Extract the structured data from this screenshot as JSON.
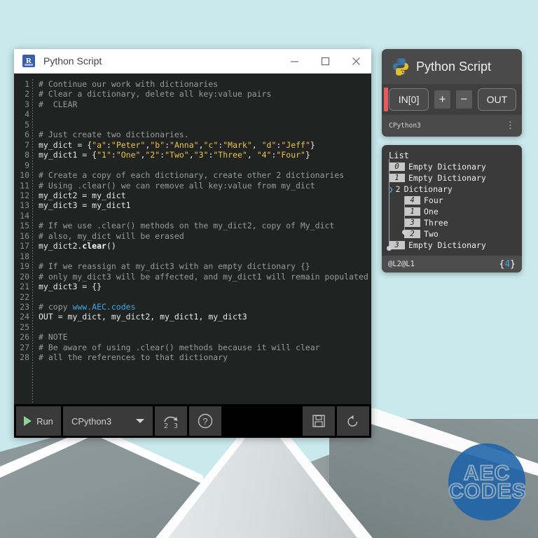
{
  "window": {
    "title": "Python Script",
    "app_icon": "revit-icon",
    "icon_letter": "R",
    "controls": {
      "minimize": "minimize-icon",
      "maximize": "maximize-icon",
      "close": "close-icon"
    }
  },
  "editor": {
    "line_numbers": [
      "1",
      "2",
      "3",
      "4",
      "5",
      "6",
      "7",
      "8",
      "9",
      "10",
      "11",
      "12",
      "13",
      "14",
      "15",
      "16",
      "17",
      "18",
      "19",
      "20",
      "21",
      "22",
      "23",
      "24",
      "25",
      "26",
      "27",
      "28"
    ],
    "lines": [
      {
        "n": 1,
        "tokens": [
          {
            "t": "# Continue our work with dictionaries",
            "c": "cmt"
          }
        ]
      },
      {
        "n": 2,
        "tokens": [
          {
            "t": "# Clear a dictionary, delete all key:value pairs",
            "c": "cmt"
          }
        ]
      },
      {
        "n": 3,
        "tokens": [
          {
            "t": "#  CLEAR",
            "c": "cmt"
          }
        ]
      },
      {
        "n": 4,
        "tokens": []
      },
      {
        "n": 5,
        "tokens": []
      },
      {
        "n": 6,
        "tokens": [
          {
            "t": "# Just create two dictionaries.",
            "c": "cmt"
          }
        ]
      },
      {
        "n": 7,
        "tokens": [
          {
            "t": "my_dict = {",
            "c": ""
          },
          {
            "t": "\"a\"",
            "c": "str"
          },
          {
            "t": ":",
            "c": ""
          },
          {
            "t": "\"Peter\"",
            "c": "str"
          },
          {
            "t": ",",
            "c": ""
          },
          {
            "t": "\"b\"",
            "c": "str"
          },
          {
            "t": ":",
            "c": ""
          },
          {
            "t": "\"Anna\"",
            "c": "str"
          },
          {
            "t": ",",
            "c": ""
          },
          {
            "t": "\"c\"",
            "c": "str"
          },
          {
            "t": ":",
            "c": ""
          },
          {
            "t": "\"Mark\"",
            "c": "str"
          },
          {
            "t": ", ",
            "c": ""
          },
          {
            "t": "\"d\"",
            "c": "str"
          },
          {
            "t": ":",
            "c": ""
          },
          {
            "t": "\"Jeff\"",
            "c": "str"
          },
          {
            "t": "}",
            "c": ""
          }
        ]
      },
      {
        "n": 8,
        "tokens": [
          {
            "t": "my_dict1 = {",
            "c": ""
          },
          {
            "t": "\"1\"",
            "c": "str"
          },
          {
            "t": ":",
            "c": ""
          },
          {
            "t": "\"One\"",
            "c": "str"
          },
          {
            "t": ",",
            "c": ""
          },
          {
            "t": "\"2\"",
            "c": "str"
          },
          {
            "t": ":",
            "c": ""
          },
          {
            "t": "\"Two\"",
            "c": "str"
          },
          {
            "t": ",",
            "c": ""
          },
          {
            "t": "\"3\"",
            "c": "str"
          },
          {
            "t": ":",
            "c": ""
          },
          {
            "t": "\"Three\"",
            "c": "str"
          },
          {
            "t": ", ",
            "c": ""
          },
          {
            "t": "\"4\"",
            "c": "str"
          },
          {
            "t": ":",
            "c": ""
          },
          {
            "t": "\"Four\"",
            "c": "str"
          },
          {
            "t": "}",
            "c": ""
          }
        ]
      },
      {
        "n": 9,
        "tokens": []
      },
      {
        "n": 10,
        "tokens": [
          {
            "t": "# Create a copy of each dictionary, create other 2 dictionaries",
            "c": "cmt"
          }
        ]
      },
      {
        "n": 11,
        "tokens": [
          {
            "t": "# Using .clear() we can remove all key:value from my_dict",
            "c": "cmt"
          }
        ]
      },
      {
        "n": 12,
        "tokens": [
          {
            "t": "my_dict2 = my_dict",
            "c": ""
          }
        ]
      },
      {
        "n": 13,
        "tokens": [
          {
            "t": "my_dict3 = my_dict1",
            "c": ""
          }
        ]
      },
      {
        "n": 14,
        "tokens": []
      },
      {
        "n": 15,
        "tokens": [
          {
            "t": "# If we use .clear() methods on the my_dict2, copy of My_dict",
            "c": "cmt"
          }
        ]
      },
      {
        "n": 16,
        "tokens": [
          {
            "t": "# also, my_dict will be erased",
            "c": "cmt"
          }
        ]
      },
      {
        "n": 17,
        "tokens": [
          {
            "t": "my_dict2.",
            "c": ""
          },
          {
            "t": "clear",
            "c": "mth"
          },
          {
            "t": "()",
            "c": ""
          }
        ]
      },
      {
        "n": 18,
        "tokens": []
      },
      {
        "n": 19,
        "tokens": [
          {
            "t": "# If we reassign at my_dict3 with an empty dictionary {}",
            "c": "cmt"
          }
        ]
      },
      {
        "n": 20,
        "tokens": [
          {
            "t": "# only my_dict3 will be affected, and my_dict1 will remain populated",
            "c": "cmt"
          }
        ]
      },
      {
        "n": 21,
        "tokens": [
          {
            "t": "my_dict3 = {}",
            "c": ""
          }
        ]
      },
      {
        "n": 22,
        "tokens": []
      },
      {
        "n": 23,
        "tokens": [
          {
            "t": "# copy ",
            "c": "cmt"
          },
          {
            "t": "www.AEC.codes",
            "c": "lnk"
          }
        ]
      },
      {
        "n": 24,
        "tokens": [
          {
            "t": "OUT = my_dict, my_dict2, my_dict1, my_dict3",
            "c": ""
          }
        ]
      },
      {
        "n": 25,
        "tokens": []
      },
      {
        "n": 26,
        "tokens": [
          {
            "t": "# NOTE",
            "c": "cmt"
          }
        ]
      },
      {
        "n": 27,
        "tokens": [
          {
            "t": "# Be aware of using .clear() methods because it will clear",
            "c": "cmt"
          }
        ]
      },
      {
        "n": 28,
        "tokens": [
          {
            "t": "# all the references to that dictionary",
            "c": "cmt"
          }
        ]
      }
    ]
  },
  "toolbar": {
    "run_label": "Run",
    "engine_value": "CPython3",
    "convert_label": "2 3",
    "convert_icon": "python2to3-icon",
    "help_icon": "help-icon",
    "save_icon": "save-icon",
    "reset_icon": "revert-icon",
    "run_icon": "play-icon",
    "caret_icon": "chevron-down-icon"
  },
  "node": {
    "title": "Python Script",
    "logo": "python-logo-icon",
    "in_port": "IN[0]",
    "add_label": "+",
    "remove_label": "−",
    "out_port": "OUT",
    "engine": "CPython3",
    "menu_icon": "kebab-menu-icon"
  },
  "watch": {
    "root_label": "List",
    "rows": [
      {
        "index": "0",
        "label": "Empty Dictionary",
        "expandable": false,
        "expanded": false,
        "depth": 0
      },
      {
        "index": "1",
        "label": "Empty Dictionary",
        "expandable": false,
        "expanded": false,
        "depth": 0
      },
      {
        "index": "2",
        "label": "Dictionary",
        "expandable": true,
        "expanded": true,
        "depth": 0
      },
      {
        "index": "4",
        "label": "Four",
        "expandable": false,
        "expanded": false,
        "depth": 1
      },
      {
        "index": "1",
        "label": "One",
        "expandable": false,
        "expanded": false,
        "depth": 1
      },
      {
        "index": "3",
        "label": "Three",
        "expandable": false,
        "expanded": false,
        "depth": 1
      },
      {
        "index": "2",
        "label": "Two",
        "expandable": false,
        "expanded": false,
        "depth": 1
      },
      {
        "index": "3",
        "label": "Empty Dictionary",
        "expandable": false,
        "expanded": false,
        "depth": 0
      }
    ],
    "path": "@L2@L1",
    "count_open": "{",
    "count": "4",
    "count_close": "}"
  },
  "logo": {
    "line1": "AEC",
    "line2": "CODES"
  },
  "colors": {
    "accent_blue": "#35aee0",
    "string_yellow": "#e8c547",
    "link_blue": "#3fa8e0",
    "error_red": "#e8585c",
    "run_green": "#8fd39a",
    "sky": "#c9e9ec",
    "logo_blue": "#1d62a8"
  }
}
